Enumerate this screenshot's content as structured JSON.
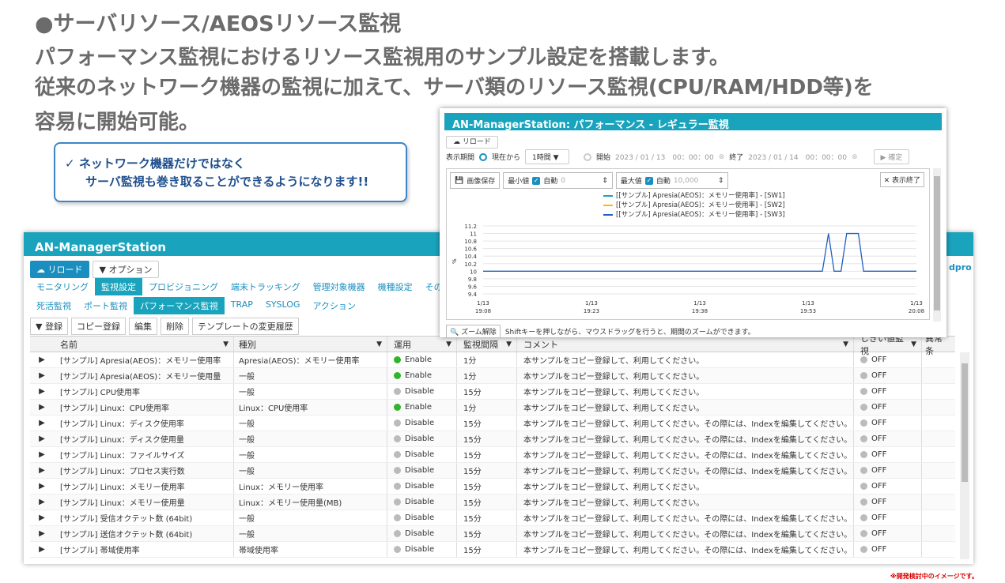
{
  "headline": {
    "line1": "●サーバリソース/AEOSリソース監視",
    "line2": "パフォーマンス監視におけるリソース監視用のサンプル設定を搭載します。",
    "line3": "従来のネットワーク機器の監視に加えて、サーバ類のリソース監視(CPU/RAM/HDD等)を",
    "line4": "容易に開始可能。"
  },
  "callout": {
    "check": "✓",
    "line1": "ネットワーク機器だけではなく",
    "line2": "サーバ監視も巻き取ることができるようになります!!"
  },
  "main": {
    "title": "AN-ManagerStation",
    "reload": "リロード",
    "options": "▼ オプション",
    "user": "dpro",
    "tabs": [
      "モニタリング",
      "監視設定",
      "プロビジョニング",
      "端末トラッキング",
      "管理対象機器",
      "機種設定",
      "その他"
    ],
    "subtabs": [
      "死活監視",
      "ポート監視",
      "パフォーマンス監視",
      "TRAP",
      "SYSLOG",
      "アクション"
    ],
    "toolbar": [
      "▼ 登録",
      "コピー登録",
      "編集",
      "削除",
      "テンプレートの変更履歴"
    ],
    "columns": [
      "名前",
      "種別",
      "運用",
      "監視間隔",
      "コメント",
      "しきい値監視",
      "異常条"
    ],
    "rows": [
      {
        "name": "[サンプル] Apresia(AEOS)：メモリー使用率",
        "type": "Apresia(AEOS)：メモリー使用率",
        "status": "Enable",
        "interval": "1分",
        "comment": "本サンプルをコピー登録して、利用してください。",
        "threshold": "OFF"
      },
      {
        "name": "[サンプル] Apresia(AEOS)：メモリー使用量",
        "type": "一般",
        "status": "Enable",
        "interval": "1分",
        "comment": "本サンプルをコピー登録して、利用してください。",
        "threshold": "OFF"
      },
      {
        "name": "[サンプル] CPU使用率",
        "type": "一般",
        "status": "Disable",
        "interval": "15分",
        "comment": "本サンプルをコピー登録して、利用してください。",
        "threshold": "OFF"
      },
      {
        "name": "[サンプル] Linux：CPU使用率",
        "type": "Linux：CPU使用率",
        "status": "Enable",
        "interval": "1分",
        "comment": "本サンプルをコピー登録して、利用してください。",
        "threshold": "OFF"
      },
      {
        "name": "[サンプル] Linux：ディスク使用率",
        "type": "一般",
        "status": "Disable",
        "interval": "15分",
        "comment": "本サンプルをコピー登録して、利用してください。その際には、Indexを編集してください。",
        "threshold": "OFF"
      },
      {
        "name": "[サンプル] Linux：ディスク使用量",
        "type": "一般",
        "status": "Disable",
        "interval": "15分",
        "comment": "本サンプルをコピー登録して、利用してください。その際には、Indexを編集してください。",
        "threshold": "OFF"
      },
      {
        "name": "[サンプル] Linux：ファイルサイズ",
        "type": "一般",
        "status": "Disable",
        "interval": "15分",
        "comment": "本サンプルをコピー登録して、利用してください。その際には、Indexを編集してください。",
        "threshold": "OFF"
      },
      {
        "name": "[サンプル] Linux：プロセス実行数",
        "type": "一般",
        "status": "Disable",
        "interval": "15分",
        "comment": "本サンプルをコピー登録して、利用してください。その際には、Indexを編集してください。",
        "threshold": "OFF"
      },
      {
        "name": "[サンプル] Linux：メモリー使用率",
        "type": "Linux：メモリー使用率",
        "status": "Disable",
        "interval": "15分",
        "comment": "本サンプルをコピー登録して、利用してください。",
        "threshold": "OFF"
      },
      {
        "name": "[サンプル] Linux：メモリー使用量",
        "type": "Linux：メモリー使用量(MB)",
        "status": "Disable",
        "interval": "15分",
        "comment": "本サンプルをコピー登録して、利用してください。",
        "threshold": "OFF"
      },
      {
        "name": "[サンプル] 受信オクテット数 (64bit)",
        "type": "一般",
        "status": "Disable",
        "interval": "15分",
        "comment": "本サンプルをコピー登録して、利用してください。その際には、Indexを編集してください。",
        "threshold": "OFF"
      },
      {
        "name": "[サンプル] 送信オクテット数 (64bit)",
        "type": "一般",
        "status": "Disable",
        "interval": "15分",
        "comment": "本サンプルをコピー登録して、利用してください。その際には、Indexを編集してください。",
        "threshold": "OFF"
      },
      {
        "name": "[サンプル] 帯域使用率",
        "type": "帯域使用率",
        "status": "Disable",
        "interval": "15分",
        "comment": "本サンプルをコピー登録して、利用してください。その際には、Indexを編集してください。",
        "threshold": "OFF"
      }
    ]
  },
  "perf": {
    "title": "AN-ManagerStation: パフォーマンス - レギュラー監視",
    "reload": "リロード",
    "period_label": "表示期間",
    "from_now": "現在から",
    "duration": "1時間",
    "start_label": "開始",
    "start": "2023 / 01 / 13　00：00：00",
    "end_label": "終了",
    "end": "2023 / 01 / 14　00：00：00",
    "confirm": "確定",
    "save_image": "画像保存",
    "min_label": "最小値",
    "min_auto": "自動",
    "min_value": "0",
    "max_label": "最大値",
    "max_auto": "自動",
    "max_value": "10,000",
    "hide_btn": "✕ 表示終了",
    "zoom_reset": "ズーム解除",
    "zoom_hint": "Shiftキーを押しながら、マウスドラッグを行うと、期間のズームができます。"
  },
  "chart_data": {
    "type": "line",
    "ylabel": "%",
    "y_ticks": [
      "9.4",
      "9.6",
      "9.8",
      "10",
      "10.2",
      "10.4",
      "10.6",
      "10.8",
      "11",
      "11.2"
    ],
    "ylim": [
      9.4,
      11.2
    ],
    "x_ticks": [
      [
        "1/13",
        "19:08"
      ],
      [
        "1/13",
        "19:23"
      ],
      [
        "1/13",
        "19:38"
      ],
      [
        "1/13",
        "19:53"
      ],
      [
        "1/13",
        "20:08"
      ]
    ],
    "series": [
      {
        "name": "[[サンプル] Apresia(AEOS)：メモリー使用率] - [SW1]",
        "color": "#1aa3bc",
        "values": [
          10,
          10,
          10,
          10,
          10
        ]
      },
      {
        "name": "[[サンプル] Apresia(AEOS)：メモリー使用率] - [SW2]",
        "color": "#f0c000",
        "values": [
          10,
          10,
          10,
          10,
          10
        ]
      },
      {
        "name": "[[サンプル] Apresia(AEOS)：メモリー使用率] - [SW3]",
        "color": "#2060c0",
        "values": [
          10,
          10,
          10,
          10,
          10
        ]
      }
    ],
    "spikes": [
      [
        0.783,
        10
      ],
      [
        0.797,
        11
      ],
      [
        0.81,
        10
      ],
      [
        0.826,
        10
      ],
      [
        0.839,
        11
      ],
      [
        0.866,
        11
      ],
      [
        0.878,
        10
      ]
    ]
  },
  "footnote": "※開発検討中のイメージです。"
}
